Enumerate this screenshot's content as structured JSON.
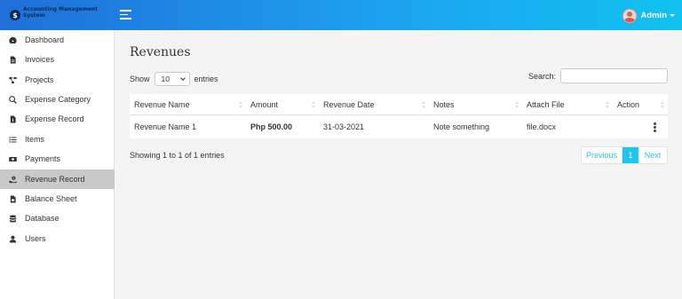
{
  "header": {
    "brand_line1": "Accounting Management",
    "brand_line2": "System",
    "user_name": "Admin"
  },
  "sidebar": {
    "items": [
      {
        "label": "Dashboard",
        "icon": "dashboard-icon"
      },
      {
        "label": "Invoices",
        "icon": "file-invoice-icon"
      },
      {
        "label": "Projects",
        "icon": "project-diagram-icon"
      },
      {
        "label": "Expense Category",
        "icon": "search-dollar-icon"
      },
      {
        "label": "Expense Record",
        "icon": "file-dollar-icon"
      },
      {
        "label": "Items",
        "icon": "list-icon"
      },
      {
        "label": "Payments",
        "icon": "money-bill-icon"
      },
      {
        "label": "Revenue Record",
        "icon": "hand-holding-dollar-icon",
        "active": true
      },
      {
        "label": "Balance Sheet",
        "icon": "file-balance-icon"
      },
      {
        "label": "Database",
        "icon": "database-icon"
      },
      {
        "label": "Users",
        "icon": "user-icon"
      }
    ]
  },
  "main": {
    "title": "Revenues",
    "show_label": "Show",
    "entries_value": "10",
    "entries_label": "entries",
    "search_label": "Search:",
    "search_value": "",
    "columns": [
      "Revenue Name",
      "Amount",
      "Revenue Date",
      "Notes",
      "Attach File",
      "Action"
    ],
    "rows": [
      {
        "name": "Revenue Name 1",
        "amount": "Php 500.00",
        "date": "31-03-2021",
        "notes": "Note something",
        "file": "file.docx"
      }
    ],
    "info": "Showing 1 to 1 of 1 entries",
    "pagination": {
      "previous": "Previous",
      "current": "1",
      "next": "Next"
    }
  },
  "colors": {
    "header_gradient_start": "#1f6fd8",
    "header_gradient_end": "#11c2f0",
    "active_sidebar": "#c9c9c9",
    "pager_accent": "#1ec5ef"
  }
}
